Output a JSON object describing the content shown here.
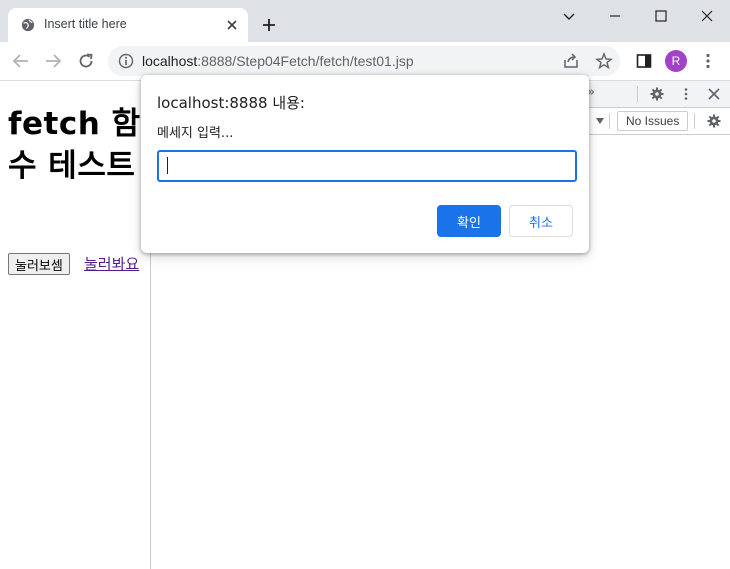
{
  "browser": {
    "tab": {
      "title": "Insert title here"
    },
    "omnibox": {
      "host": "localhost",
      "rest": ":8888/Step04Fetch/fetch/test01.jsp"
    },
    "profile": {
      "initial": "R",
      "color": "#a142c9"
    }
  },
  "page": {
    "heading": "fetch 함수 테스트",
    "button_label": "눌러보셈",
    "link_label": "눌러봐요"
  },
  "devtools": {
    "more_tabs": "»",
    "issues_label": "No Issues"
  },
  "dialog": {
    "title": "localhost:8888 내용:",
    "message": "메세지 입력...",
    "input_value": "",
    "ok_label": "확인",
    "cancel_label": "취소"
  },
  "colors": {
    "accent": "#1a73e8",
    "link_visited": "#551a8b",
    "tabstrip": "#dee1e6"
  }
}
